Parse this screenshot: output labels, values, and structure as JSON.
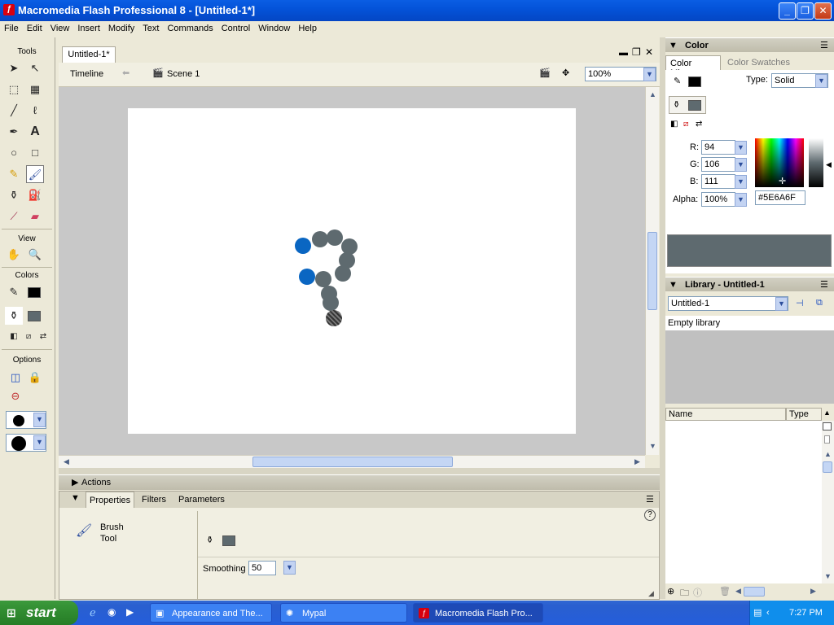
{
  "window": {
    "title": "Macromedia Flash Professional 8 - [Untitled-1*]",
    "app_icon": "flash-icon"
  },
  "menu": [
    "File",
    "Edit",
    "View",
    "Insert",
    "Modify",
    "Text",
    "Commands",
    "Control",
    "Window",
    "Help"
  ],
  "tools": {
    "title": "Tools",
    "view_label": "View",
    "colors_label": "Colors",
    "options_label": "Options"
  },
  "document": {
    "tab": "Untitled-1*",
    "timeline_label": "Timeline",
    "scene_label": "Scene 1",
    "zoom": "100%"
  },
  "actions_panel": {
    "title": "Actions"
  },
  "properties_panel": {
    "tabs": [
      "Properties",
      "Filters",
      "Parameters"
    ],
    "tool_name": "Brush",
    "tool_sub": "Tool",
    "smoothing_label": "Smoothing",
    "smoothing_value": "50",
    "help": "?"
  },
  "color_panel": {
    "title": "Color",
    "tabs": [
      "Color Mixer",
      "Color Swatches"
    ],
    "type_label": "Type:",
    "type_value": "Solid",
    "r_label": "R:",
    "r": "94",
    "g_label": "G:",
    "g": "106",
    "b_label": "B:",
    "b": "111",
    "alpha_label": "Alpha:",
    "alpha": "100%",
    "hex": "#5E6A6F",
    "fill_color": "#5E6A6F"
  },
  "library_panel": {
    "title": "Library - Untitled-1",
    "selected": "Untitled-1",
    "empty_text": "Empty library",
    "col_name": "Name",
    "col_type": "Type"
  },
  "taskbar": {
    "start": "start",
    "tasks": [
      "Appearance and The...",
      "Mypal",
      "Macromedia Flash Pro..."
    ],
    "clock": "7:27 PM"
  }
}
